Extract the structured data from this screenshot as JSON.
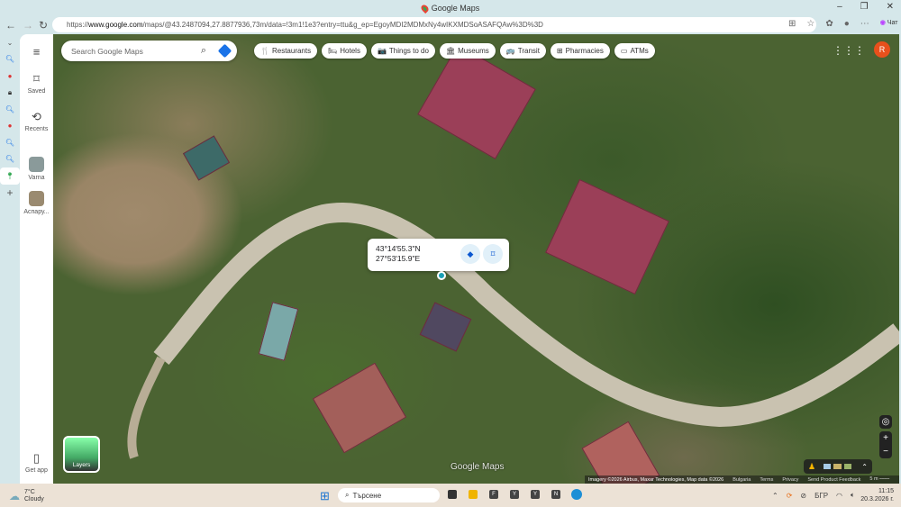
{
  "browser": {
    "tab_title": "Google Maps",
    "url_prefix": "https://",
    "url_host": "www.google.com",
    "url_rest": "/maps/@43.2487094,27.8877936,73m/data=!3m1!1e3?entry=ttu&g_ep=EgoyMDI2MDMxNy4wIKXMDSoASAFQAw%3D%3D",
    "copilot_label": "Чат"
  },
  "maps": {
    "menu_label": "Menu",
    "saved_label": "Saved",
    "recents_label": "Recents",
    "recent_places": [
      {
        "label": "Varna"
      },
      {
        "label": "Аспару..."
      }
    ],
    "get_app_label": "Get app",
    "search_placeholder": "Search Google Maps",
    "chips": [
      {
        "label": "Restaurants",
        "icon": "🍴"
      },
      {
        "label": "Hotels",
        "icon": "🛏"
      },
      {
        "label": "Things to do",
        "icon": "📷"
      },
      {
        "label": "Museums",
        "icon": "🏛"
      },
      {
        "label": "Transit",
        "icon": "🚌"
      },
      {
        "label": "Pharmacies",
        "icon": "⊞"
      },
      {
        "label": "ATMs",
        "icon": "▭"
      }
    ],
    "avatar_letter": "R",
    "popup": {
      "lat": "43°14'55.3\"N",
      "lng": "27°53'15.9\"E"
    },
    "layers_label": "Layers",
    "watermark": "Google Maps",
    "footer": {
      "imagery": "Imagery ©2026 Airbus, Maxar Technologies, Map data ©2026",
      "country": "Bulgaria",
      "terms": "Terms",
      "privacy": "Privacy",
      "feedback": "Send Product Feedback",
      "scale": "5 m"
    }
  },
  "taskbar": {
    "temp": "7°C",
    "weather": "Cloudy",
    "search_placeholder": "Търсене",
    "lang": "БГР",
    "time": "11:15",
    "date": "20.3.2026 г.",
    "apps": [
      "F",
      "Y",
      "Y",
      "N"
    ]
  },
  "colors": {
    "accent": "#1a73e8",
    "avatar": "#e8501c"
  }
}
